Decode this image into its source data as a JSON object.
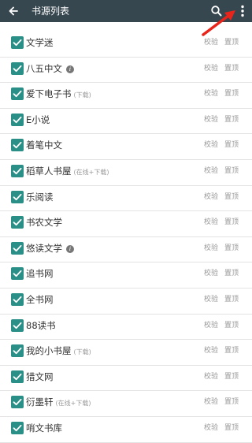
{
  "toolbar": {
    "title": "书源列表",
    "back_icon": "arrow-left-icon",
    "search_icon": "search-icon",
    "more_icon": "more-vertical-icon",
    "background": "#37474f"
  },
  "annotation": {
    "icon": "red-arrow-icon",
    "color": "#e8241b"
  },
  "colors": {
    "checkbox": "#2a8f86"
  },
  "actions": {
    "verify": "校验",
    "top": "置顶"
  },
  "sources": [
    {
      "name": "文学迷",
      "tag": "",
      "info": false,
      "checked": true
    },
    {
      "name": "八五中文",
      "tag": "",
      "info": true,
      "checked": true
    },
    {
      "name": "爱下电子书",
      "tag": "(下载)",
      "info": false,
      "checked": true
    },
    {
      "name": "E小说",
      "tag": "",
      "info": false,
      "checked": true
    },
    {
      "name": "着笔中文",
      "tag": "",
      "info": false,
      "checked": true
    },
    {
      "name": "稻草人书屋",
      "tag": "(在线+下载)",
      "info": false,
      "checked": true
    },
    {
      "name": "乐阅读",
      "tag": "",
      "info": false,
      "checked": true
    },
    {
      "name": "书农文学",
      "tag": "",
      "info": false,
      "checked": true
    },
    {
      "name": "悠读文学",
      "tag": "",
      "info": true,
      "checked": true
    },
    {
      "name": "追书网",
      "tag": "",
      "info": false,
      "checked": true
    },
    {
      "name": "全书网",
      "tag": "",
      "info": false,
      "checked": true
    },
    {
      "name": "88读书",
      "tag": "",
      "info": false,
      "checked": true
    },
    {
      "name": "我的小书屋",
      "tag": "(下载)",
      "info": false,
      "checked": true
    },
    {
      "name": "猎文网",
      "tag": "",
      "info": false,
      "checked": true
    },
    {
      "name": "衍墨轩",
      "tag": "(在线+下载)",
      "info": false,
      "checked": true
    },
    {
      "name": "哨文书库",
      "tag": "",
      "info": false,
      "checked": true
    }
  ]
}
